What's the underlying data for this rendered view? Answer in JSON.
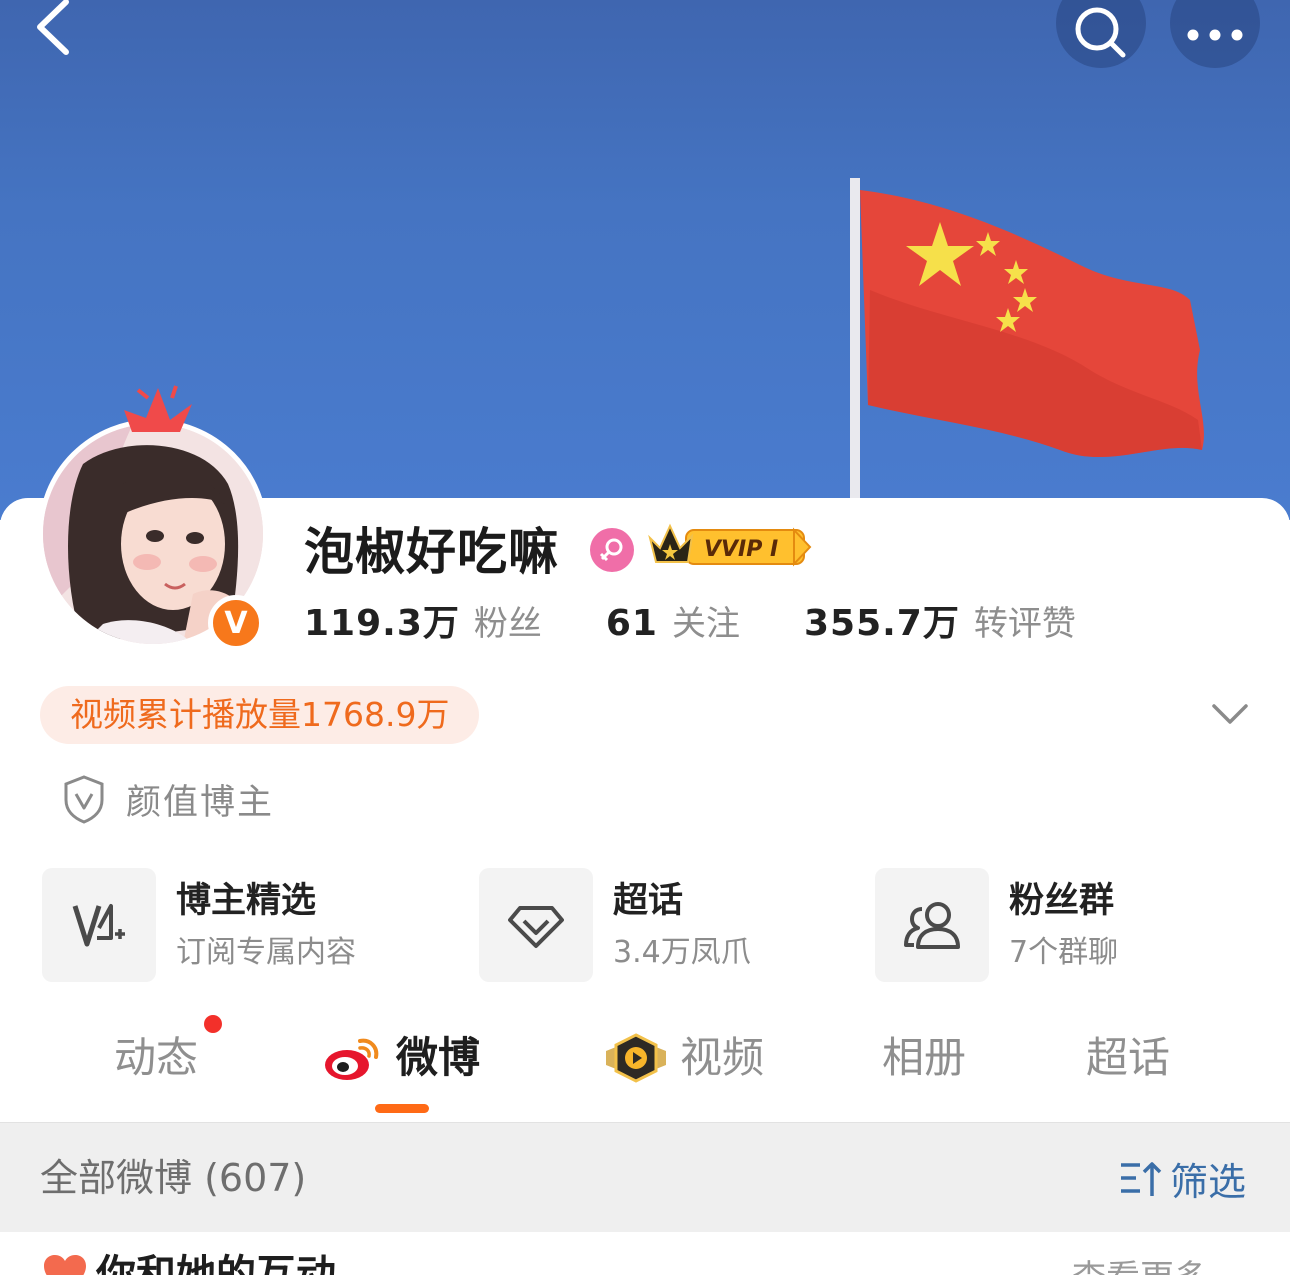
{
  "header": {
    "back_icon": "chevron-left-icon",
    "search_icon": "search-icon",
    "more_icon": "ellipsis-icon"
  },
  "profile": {
    "name": "泡椒好吃嘛",
    "gender_icon": "female-icon",
    "vip_badge": "VVIP I",
    "verified_badge": "V",
    "stats": [
      {
        "value": "119.3万",
        "label": "粉丝"
      },
      {
        "value": "61",
        "label": "关注"
      },
      {
        "value": "355.7万",
        "label": "转评赞"
      }
    ],
    "play_count_pill": "视频累计播放量1768.9万",
    "tag": "颜值博主"
  },
  "features": [
    {
      "title": "博主精选",
      "subtitle": "订阅专属内容",
      "icon": "v-plus-icon"
    },
    {
      "title": "超话",
      "subtitle": "3.4万凤爪",
      "icon": "diamond-icon"
    },
    {
      "title": "粉丝群",
      "subtitle": "7个群聊",
      "icon": "group-icon"
    }
  ],
  "tabs": [
    {
      "label": "动态",
      "active": false,
      "has_dot": true
    },
    {
      "label": "微博",
      "active": true
    },
    {
      "label": "视频",
      "active": false
    },
    {
      "label": "相册",
      "active": false
    },
    {
      "label": "超话",
      "active": false
    }
  ],
  "list": {
    "count_label": "全部微博 (607)",
    "filter_label": "筛选"
  },
  "interaction": {
    "title": "你和她的互动",
    "more": "查看更多"
  },
  "colors": {
    "accent_orange": "#ff6a16",
    "link_blue": "#3a6ea8",
    "pill_bg": "#fdece6",
    "pill_text": "#ef6a1d"
  }
}
